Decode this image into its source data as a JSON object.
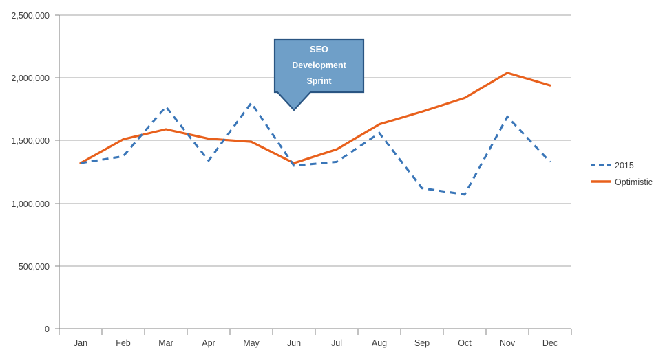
{
  "chart_data": {
    "type": "line",
    "title": "",
    "xlabel": "",
    "ylabel": "",
    "categories": [
      "Jan",
      "Feb",
      "Mar",
      "Apr",
      "May",
      "Jun",
      "Jul",
      "Aug",
      "Sep",
      "Oct",
      "Nov",
      "Dec"
    ],
    "series": [
      {
        "name": "2015",
        "style": "dashed",
        "color": "#3a76b8",
        "values": [
          1320000,
          1375000,
          1770000,
          1340000,
          1800000,
          1300000,
          1330000,
          1560000,
          1120000,
          1070000,
          1690000,
          1330000
        ]
      },
      {
        "name": "Optimistic",
        "style": "solid",
        "color": "#e8601c",
        "values": [
          1320000,
          1510000,
          1590000,
          1515000,
          1490000,
          1320000,
          1430000,
          1630000,
          1730000,
          1840000,
          2040000,
          1940000
        ]
      }
    ],
    "ylim": [
      0,
      2500000
    ],
    "yticks": [
      0,
      500000,
      1000000,
      1500000,
      2000000,
      2500000
    ],
    "ytick_labels": [
      "0",
      "500,000",
      "1,000,000",
      "1,500,000",
      "2,000,000",
      "2,500,000"
    ],
    "grid": "horizontal",
    "legend_position": "right",
    "annotations": [
      {
        "name": "seo-development-sprint-callout",
        "lines": [
          "SEO",
          "Development",
          "Sprint"
        ],
        "anchor_category": "Jun",
        "fill": "#6f9fc8",
        "border": "#2a5582",
        "text_color": "#ffffff"
      }
    ],
    "colors": {
      "axis": "#868686",
      "gridline": "#a6a6a6",
      "tick_text": "#404040",
      "series_2015": "#3a76b8",
      "series_optimistic": "#e8601c",
      "callout_fill": "#6f9fc8",
      "callout_border": "#2a5582"
    }
  },
  "legend": {
    "items": [
      {
        "label": "2015"
      },
      {
        "label": "Optimistic"
      }
    ]
  }
}
